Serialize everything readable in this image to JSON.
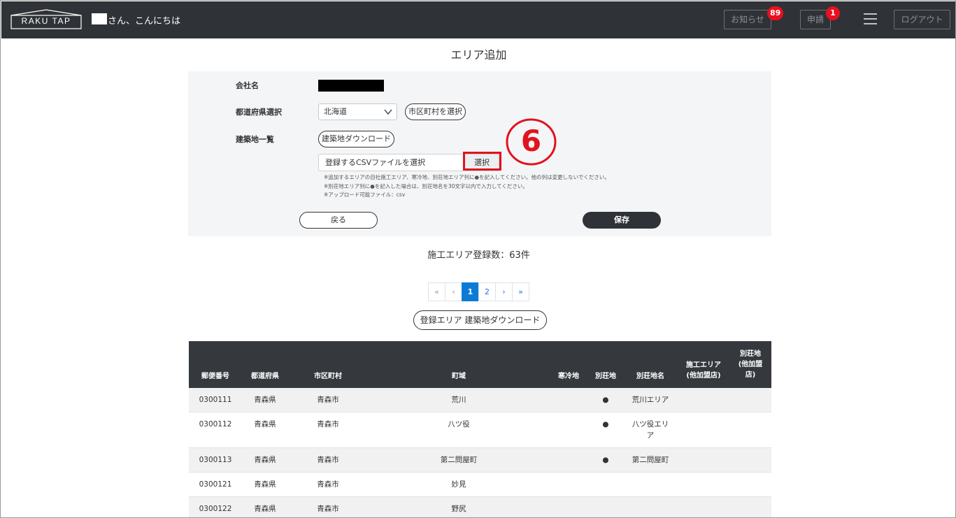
{
  "header": {
    "logo_text": "RAKU TAP",
    "greeting": "さん、こんにちは",
    "notice_label": "お知らせ",
    "notice_count": "89",
    "apply_label": "申請",
    "apply_count": "1",
    "logout_label": "ログアウト"
  },
  "page": {
    "title": "エリア追加"
  },
  "form": {
    "company_label": "会社名",
    "prefecture_label": "都道府県選択",
    "prefecture_value": "北海道",
    "city_select_button": "市区町村を選択",
    "site_list_label": "建築地一覧",
    "site_download_button": "建築地ダウンロード",
    "file_placeholder": "登録するCSVファイルを選択",
    "file_select_button": "選択",
    "annotation_number": "6",
    "notes": [
      "※追加するエリアの自社施工エリア、寒冷地、別荘地エリア列に●を記入してください。他の列は変更しないでください。",
      "※別荘地エリア列に●を記入した場合は、別荘地名を30文字以内で入力してください。",
      "※アップロード可能ファイル：csv"
    ],
    "back_button": "戻る",
    "save_button": "保存"
  },
  "summary": {
    "registered_count": "施工エリア登録数：63件"
  },
  "pagination": {
    "first": "«",
    "prev": "‹",
    "pages": [
      "1",
      "2"
    ],
    "current": "1",
    "next": "›",
    "last": "»"
  },
  "area_download_button": "登録エリア 建築地ダウンロード",
  "table": {
    "headers": {
      "postal": "郵便番号",
      "prefecture": "都道府県",
      "city": "市区町村",
      "town": "町域",
      "cold": "寒冷地",
      "villa": "別荘地",
      "villa_name": "別荘地名",
      "construction_area": "施工エリア\n(他加盟店)",
      "villa_member": "別荘地\n(他加盟\n店)"
    },
    "rows": [
      {
        "postal": "0300111",
        "prefecture": "青森県",
        "city": "青森市",
        "town": "荒川",
        "cold": "",
        "villa": "●",
        "villa_name": "荒川エリア"
      },
      {
        "postal": "0300112",
        "prefecture": "青森県",
        "city": "青森市",
        "town": "八ツ役",
        "cold": "",
        "villa": "●",
        "villa_name": "八ツ役エリ\nア"
      },
      {
        "postal": "0300113",
        "prefecture": "青森県",
        "city": "青森市",
        "town": "第二問屋町",
        "cold": "",
        "villa": "●",
        "villa_name": "第二問屋町"
      },
      {
        "postal": "0300121",
        "prefecture": "青森県",
        "city": "青森市",
        "town": "妙見",
        "cold": "",
        "villa": "",
        "villa_name": ""
      },
      {
        "postal": "0300122",
        "prefecture": "青森県",
        "city": "青森市",
        "town": "野尻",
        "cold": "",
        "villa": "",
        "villa_name": ""
      }
    ]
  },
  "colors": {
    "header_bg": "#2f3236",
    "badge": "#e8101f",
    "annotation": "#e0141e",
    "pager_active": "#0d7bd6"
  }
}
